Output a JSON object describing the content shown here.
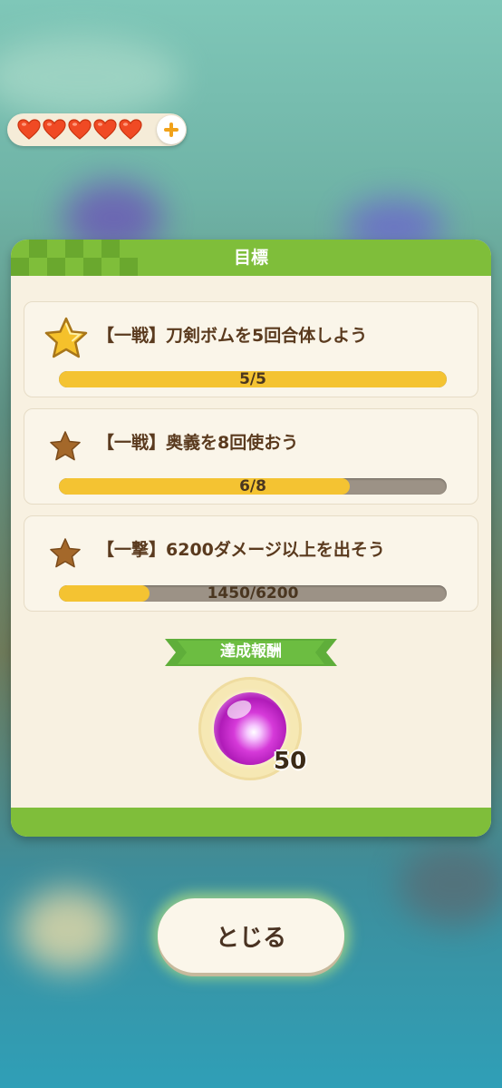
{
  "hearts": {
    "count": 5,
    "color": "#f04a24"
  },
  "panel": {
    "title": "目標",
    "accent_color": "#7fbe3a"
  },
  "objectives": [
    {
      "text": "【一戦】刀剣ボムを5回合体しよう",
      "progress_text": "5/5",
      "progress": 1.0,
      "star": "gold-star-icon",
      "achieved": true
    },
    {
      "text": "【一戦】奥義を8回使おう",
      "progress_text": "6/8",
      "progress": 0.75,
      "star": "bronze-star-icon",
      "achieved": false
    },
    {
      "text": "【一撃】6200ダメージ以上を出そう",
      "progress_text": "1450/6200",
      "progress": 0.2339,
      "star": "bronze-star-icon",
      "achieved": false
    }
  ],
  "reward": {
    "label": "達成報酬",
    "item_icon": "purple-orb-icon",
    "count": "50"
  },
  "close_button": {
    "label": "とじる"
  }
}
